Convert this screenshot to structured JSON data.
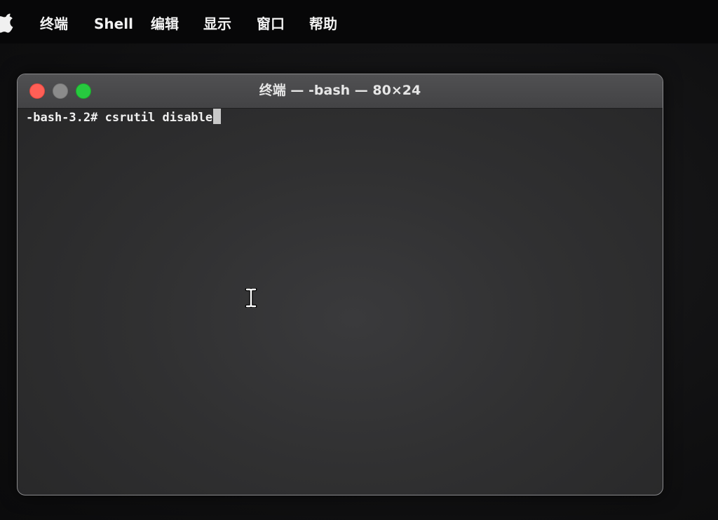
{
  "menubar": {
    "items": [
      {
        "label": "终端"
      },
      {
        "label": "Shell"
      },
      {
        "label": "编辑"
      },
      {
        "label": "显示"
      },
      {
        "label": "窗口"
      },
      {
        "label": "帮助"
      }
    ],
    "apple_icon": "apple-logo-icon"
  },
  "window": {
    "title": "终端 — -bash — 80×24",
    "buttons": {
      "close": {
        "icon": "close-icon",
        "color": "#ff5f56"
      },
      "minimize": {
        "icon": "minimize-icon",
        "color": "#8b8b8b"
      },
      "zoom": {
        "icon": "zoom-icon",
        "color": "#27c93f"
      }
    }
  },
  "terminal": {
    "prompt": "-bash-3.2#",
    "command": "csrutil disable",
    "pointer_icon": "text-ibeam-cursor-icon"
  }
}
